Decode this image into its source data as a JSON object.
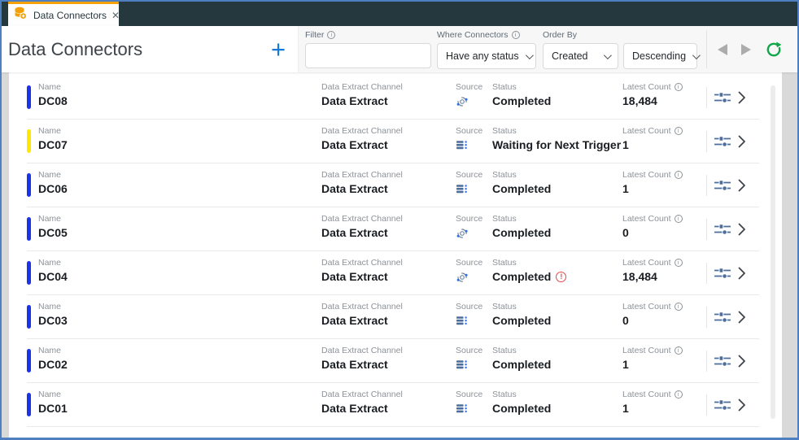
{
  "tab_bar": {
    "tab": {
      "label": "Data Connectors",
      "close_icon": "✕"
    }
  },
  "toolbar": {
    "title": "Data Connectors",
    "add_button": "+",
    "filter": {
      "label": "Filter",
      "value": ""
    },
    "where_connectors": {
      "label": "Where Connectors",
      "value": "Have any status"
    },
    "order_by": {
      "label": "Order By",
      "field": "Created",
      "direction": "Descending"
    }
  },
  "icons": {
    "info_glyph": "i",
    "warning_glyph": "!"
  },
  "colors": {
    "tab_accent": "#F2A10A",
    "header_bg": "#25383E",
    "window_border": "#4E80C1",
    "accent_blue": "#1779D8",
    "refresh_green": "#12A64B",
    "warning_red": "#E5484D",
    "bar_blue": "#1C33E8",
    "bar_yellow": "#FFE800",
    "source_icon_steel": "#4C6E9C"
  },
  "list": {
    "column_labels": {
      "name": "Name",
      "channel": "Data Extract Channel",
      "source": "Source",
      "status": "Status",
      "latest_count": "Latest Count"
    },
    "bar_colors": {
      "blue": "#1C33E8",
      "yellow": "#FFE800"
    },
    "rows": [
      {
        "name": "DC08",
        "channel": "Data Extract",
        "source_icon": "process",
        "status": "Completed",
        "status_warning": false,
        "latest_count": "18,484",
        "bar": "blue"
      },
      {
        "name": "DC07",
        "channel": "Data Extract",
        "source_icon": "database",
        "status": "Waiting for Next Trigger",
        "status_warning": false,
        "latest_count": "1",
        "bar": "yellow"
      },
      {
        "name": "DC06",
        "channel": "Data Extract",
        "source_icon": "database",
        "status": "Completed",
        "status_warning": false,
        "latest_count": "1",
        "bar": "blue"
      },
      {
        "name": "DC05",
        "channel": "Data Extract",
        "source_icon": "process",
        "status": "Completed",
        "status_warning": false,
        "latest_count": "0",
        "bar": "blue"
      },
      {
        "name": "DC04",
        "channel": "Data Extract",
        "source_icon": "process",
        "status": "Completed",
        "status_warning": true,
        "latest_count": "18,484",
        "bar": "blue"
      },
      {
        "name": "DC03",
        "channel": "Data Extract",
        "source_icon": "database",
        "status": "Completed",
        "status_warning": false,
        "latest_count": "0",
        "bar": "blue"
      },
      {
        "name": "DC02",
        "channel": "Data Extract",
        "source_icon": "database",
        "status": "Completed",
        "status_warning": false,
        "latest_count": "1",
        "bar": "blue"
      },
      {
        "name": "DC01",
        "channel": "Data Extract",
        "source_icon": "database",
        "status": "Completed",
        "status_warning": false,
        "latest_count": "1",
        "bar": "blue"
      }
    ]
  }
}
